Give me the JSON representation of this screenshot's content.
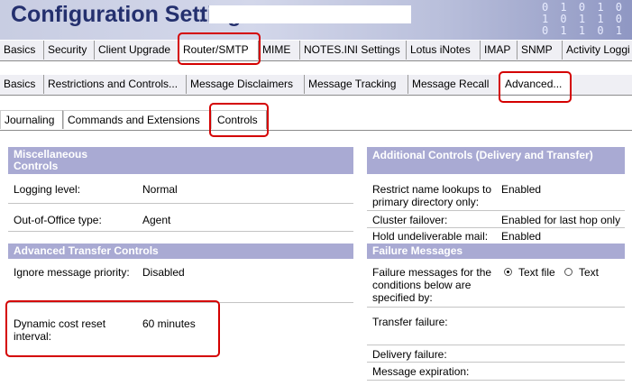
{
  "header": {
    "title": "Configuration Settings",
    "separator": ":",
    "name_value": ""
  },
  "tabs_main": [
    "Basics",
    "Security",
    "Client Upgrade",
    "Router/SMTP",
    "MIME",
    "NOTES.INI Settings",
    "Lotus iNotes",
    "IMAP",
    "SNMP",
    "Activity Loggi"
  ],
  "tabs_router": [
    "Basics",
    "Restrictions and Controls...",
    "Message Disclaimers",
    "Message Tracking",
    "Message Recall",
    "Advanced..."
  ],
  "tabs_advanced": [
    "Journaling",
    "Commands and Extensions",
    "Controls"
  ],
  "left": {
    "misc_header": "Miscellaneous Controls",
    "logging_label": "Logging level:",
    "logging_value": "Normal",
    "ooo_label": "Out-of-Office type:",
    "ooo_value": "Agent",
    "atc_header": "Advanced Transfer Controls",
    "priority_label": "Ignore message priority:",
    "priority_value": "Disabled",
    "dcr_label": "Dynamic cost reset interval:",
    "dcr_value": "60 minutes"
  },
  "right": {
    "adc_header": "Additional Controls (Delivery and Transfer)",
    "restrict_label": "Restrict name lookups to primary directory only:",
    "restrict_value": "Enabled",
    "cluster_label": "Cluster failover:",
    "cluster_value": "Enabled for last hop only",
    "hold_label": "Hold undeliverable mail:",
    "hold_value": "Enabled",
    "fm_header": "Failure Messages",
    "fm_label": "Failure messages for the conditions below are specified by:",
    "fm_option1": "Text file",
    "fm_option2": "Text",
    "fm_selected": "Text file",
    "transfer_label": "Transfer failure:",
    "delivery_label": "Delivery failure:",
    "expiration_label": "Message expiration:"
  }
}
